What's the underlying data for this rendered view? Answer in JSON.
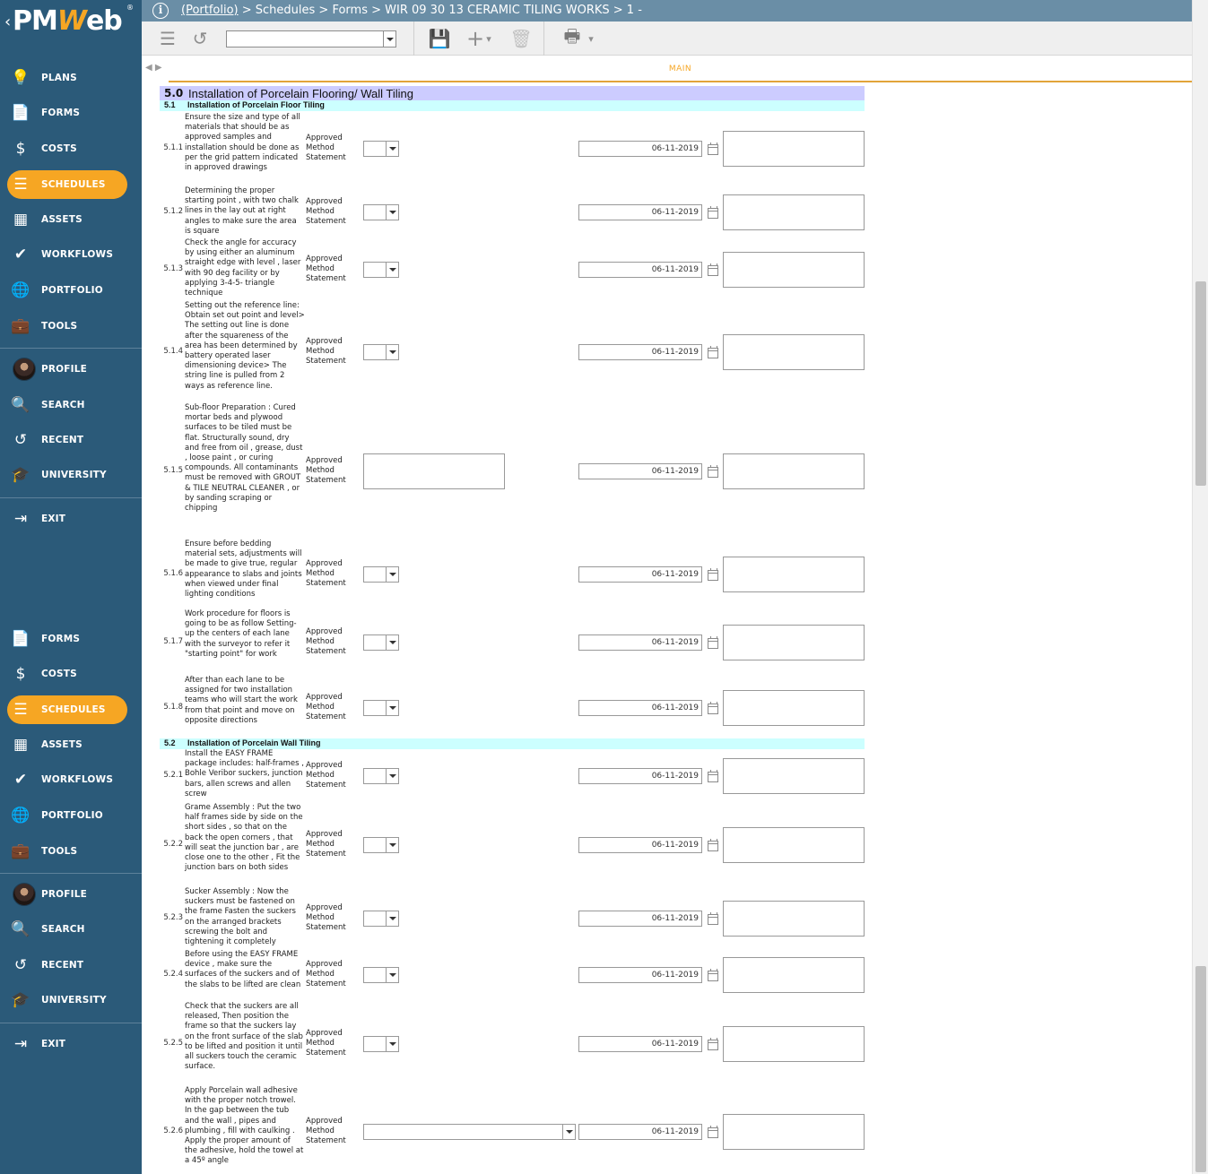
{
  "app": {
    "logo_prefix": "PM",
    "logo_w": "W",
    "logo_suffix": "eb",
    "logo_reg": "®",
    "back_glyph": "‹"
  },
  "header": {
    "info_glyph": "i",
    "portfolio": "(Portfolio)",
    "rest": " > Schedules > Forms > WIR 09 30 13 CERAMIC TILING WORKS > 1 -"
  },
  "nav_groups": [
    [
      {
        "label": "PLANS",
        "icon": "lightbulb-icon",
        "glyph": "💡"
      },
      {
        "label": "FORMS",
        "icon": "document-icon",
        "glyph": "📄"
      },
      {
        "label": "COSTS",
        "icon": "dollar-icon",
        "glyph": "$"
      },
      {
        "label": "SCHEDULES",
        "icon": "schedule-icon",
        "glyph": "☰",
        "active": true
      },
      {
        "label": "ASSETS",
        "icon": "building-icon",
        "glyph": "▦"
      },
      {
        "label": "WORKFLOWS",
        "icon": "checkmark-icon",
        "glyph": "✔"
      },
      {
        "label": "PORTFOLIO",
        "icon": "globe-icon",
        "glyph": "🌐"
      },
      {
        "label": "TOOLS",
        "icon": "briefcase-icon",
        "glyph": "💼"
      }
    ],
    [
      {
        "label": "PROFILE",
        "icon": "avatar",
        "glyph": ""
      },
      {
        "label": "SEARCH",
        "icon": "search-icon",
        "glyph": "🔍"
      },
      {
        "label": "RECENT",
        "icon": "history-icon",
        "glyph": "↺"
      },
      {
        "label": "UNIVERSITY",
        "icon": "graduation-cap-icon",
        "glyph": "🎓"
      }
    ],
    [
      {
        "label": "EXIT",
        "icon": "exit-icon",
        "glyph": "⇥"
      }
    ],
    [
      {
        "label": "FORMS",
        "icon": "document-icon",
        "glyph": "📄"
      },
      {
        "label": "COSTS",
        "icon": "dollar-icon",
        "glyph": "$"
      },
      {
        "label": "SCHEDULES",
        "icon": "schedule-icon",
        "glyph": "☰",
        "active": true
      },
      {
        "label": "ASSETS",
        "icon": "building-icon",
        "glyph": "▦"
      },
      {
        "label": "WORKFLOWS",
        "icon": "checkmark-icon",
        "glyph": "✔"
      },
      {
        "label": "PORTFOLIO",
        "icon": "globe-icon",
        "glyph": "🌐"
      },
      {
        "label": "TOOLS",
        "icon": "briefcase-icon",
        "glyph": "💼"
      }
    ],
    [
      {
        "label": "PROFILE",
        "icon": "avatar",
        "glyph": ""
      },
      {
        "label": "SEARCH",
        "icon": "search-icon",
        "glyph": "🔍"
      },
      {
        "label": "RECENT",
        "icon": "history-icon",
        "glyph": "↺"
      },
      {
        "label": "UNIVERSITY",
        "icon": "graduation-cap-icon",
        "glyph": "🎓"
      }
    ],
    [
      {
        "label": "EXIT",
        "icon": "exit-icon",
        "glyph": "⇥"
      }
    ]
  ],
  "toolbar": {
    "list_glyph": "☰",
    "undo_glyph": "↺",
    "select_value": "",
    "save_glyph": "💾",
    "add_glyph": "+",
    "dropdown_caret": "▾",
    "delete_glyph": "🗑",
    "print_glyph": "🖶"
  },
  "tabs": {
    "nav_arrows": "◀ ▶",
    "main_label": "MAIN"
  },
  "colors": {
    "sidebar": "#2b5a79",
    "header": "#6a8ea6",
    "accent": "#f6a623",
    "section_bg": "#ccccff",
    "subsection_bg": "#ccffff"
  },
  "section": {
    "number": "5.0",
    "title": "Installation of Porcelain Flooring/ Wall Tiling"
  },
  "subsections": [
    {
      "number": "5.1",
      "title": "Installation of Porcelain Floor Tiling",
      "rows": [
        {
          "num": "5.1.1",
          "desc": "Ensure the size and type of all materials that should be as approved samples and installation should be done as per the grid pattern indicated in approved drawings",
          "method": "Approved Method Statement",
          "control": "select",
          "date": "06-11-2019"
        },
        {
          "num": "5.1.2",
          "desc": "Determining the proper starting point , with two chalk lines in the lay out at right angles to make sure the area is square",
          "method": "Approved Method Statement",
          "control": "select",
          "date": "06-11-2019"
        },
        {
          "num": "5.1.3",
          "desc": "Check the angle for accuracy by using either an aluminum straight edge with level , laser with 90 deg facility or by applying 3-4-5- triangle technique",
          "method": "Approved Method Statement",
          "control": "select",
          "date": "06-11-2019"
        },
        {
          "num": "5.1.4",
          "desc": "Setting out the reference line: Obtain set out point and level> The setting out line is done after the squareness of the area has been determined by battery operated laser dimensioning device> The string line is pulled from 2 ways as reference line.",
          "method": "Approved Method Statement",
          "control": "select",
          "date": "06-11-2019"
        },
        {
          "num": "5.1.5",
          "desc": "Sub-floor Preparation : Cured mortar beds and plywood surfaces to be tiled must be flat. Structurally sound, dry and free from oil , grease, dust , loose paint , or curing compounds. All contaminants must be removed with GROUT & TILE NEUTRAL CLEANER , or by sanding scraping or chipping",
          "method": "Approved Method Statement",
          "control": "textbox",
          "date": "06-11-2019"
        },
        {
          "num": "5.1.6",
          "desc": "Ensure before bedding material sets, adjustments will be made to give true, regular appearance to slabs and joints when viewed under final lighting conditions",
          "method": "Approved Method Statement",
          "control": "select",
          "date": "06-11-2019"
        },
        {
          "num": "5.1.7",
          "desc": "Work procedure for floors is going to be as follow Setting-up the centers of each lane with the surveyor to refer it \"starting point\" for work",
          "method": "Approved Method Statement",
          "control": "select",
          "date": "06-11-2019"
        },
        {
          "num": "5.1.8",
          "desc": "After than each lane to be assigned for two installation teams who will start the work from that point and move on opposite directions",
          "method": "Approved Method Statement",
          "control": "select",
          "date": "06-11-2019"
        }
      ]
    },
    {
      "number": "5.2",
      "title": "Installation of Porcelain Wall Tiling",
      "rows": [
        {
          "num": "5.2.1",
          "desc": "Install the EASY FRAME package includes: half-frames , Bohle Veribor suckers, junction bars, allen screws and allen screw",
          "method": "Approved Method Statement",
          "control": "select",
          "date": "06-11-2019"
        },
        {
          "num": "5.2.2",
          "desc": "Grame Assembly : Put the two half frames side by side on the short sides , so that on the back the open corners , that will seat the junction bar , are close one to the other , Fit the junction bars on both sides",
          "method": "Approved Method Statement",
          "control": "select",
          "date": "06-11-2019"
        },
        {
          "num": "5.2.3",
          "desc": "Sucker Assembly : Now the suckers must be fastened on the frame Fasten the suckers on the arranged brackets screwing the bolt and tightening it completely",
          "method": "Approved Method Statement",
          "control": "select",
          "date": "06-11-2019"
        },
        {
          "num": "5.2.4",
          "desc": "Before using the EASY FRAME device , make sure the surfaces of the suckers and of the slabs to be lifted are clean",
          "method": "Approved Method Statement",
          "control": "select",
          "date": "06-11-2019"
        },
        {
          "num": "5.2.5",
          "desc": "Check that the suckers are all released, Then position the frame so that the suckers lay on the front surface of the slab to be lifted and position it until all suckers touch the ceramic surface.",
          "method": "Approved Method Statement",
          "control": "select",
          "date": "06-11-2019"
        },
        {
          "num": "5.2.6",
          "desc": "Apply Porcelain wall adhesive with the proper notch trowel. In the gap between the tub and the wall , pipes and plumbing , fill with caulking . Apply the proper amount of the adhesive, hold the towel at a 45º angle",
          "method": "Approved Method Statement",
          "control": "select-wide",
          "date": "06-11-2019"
        }
      ]
    }
  ]
}
